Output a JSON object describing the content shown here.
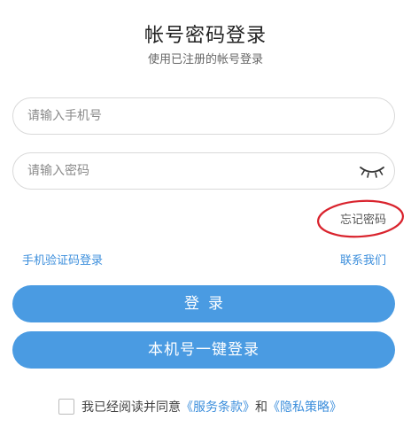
{
  "header": {
    "title": "帐号密码登录",
    "subtitle": "使用已注册的帐号登录"
  },
  "form": {
    "phone_placeholder": "请输入手机号",
    "phone_value": "",
    "password_placeholder": "请输入密码",
    "password_value": "",
    "password_toggle_icon": "eye-closed-icon",
    "forgot_password": "忘记密码",
    "sms_login": "手机验证码登录",
    "contact_us": "联系我们",
    "login_button": "登录",
    "onekey_button": "本机号一键登录"
  },
  "agreement": {
    "checked": false,
    "prefix": "我已经阅读并同意",
    "terms": "《服务条款》",
    "and": "和",
    "privacy": "《隐私策略》"
  },
  "colors": {
    "accent": "#4a9be2",
    "link": "#3d8fdc",
    "highlight_circle": "#d9232d"
  }
}
